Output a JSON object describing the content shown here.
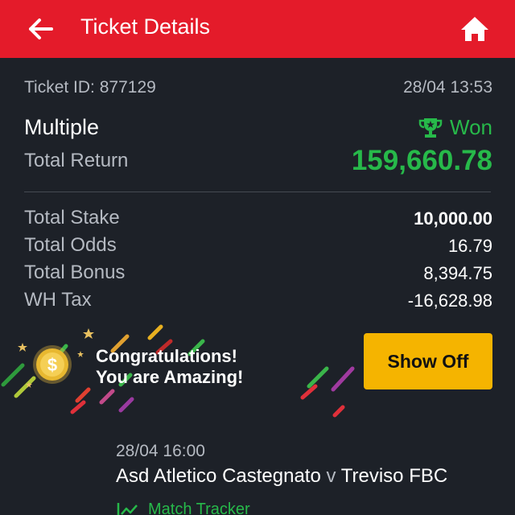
{
  "header": {
    "title": "Ticket Details",
    "back_icon": "arrow-left-icon",
    "home_icon": "home-icon",
    "background": "#e41b2a"
  },
  "ticket": {
    "id_text": "Ticket ID: 877129",
    "date": "28/04 13:53",
    "bet_type": "Multiple",
    "status": "Won",
    "status_icon": "trophy-icon",
    "status_color": "#27b94a",
    "return_label": "Total Return",
    "return_value": "159,660.78"
  },
  "summary": [
    {
      "label": "Total Stake",
      "value": "10,000.00"
    },
    {
      "label": "Total Odds",
      "value": "16.79"
    },
    {
      "label": "Total Bonus",
      "value": "8,394.75"
    },
    {
      "label": "WH Tax",
      "value": "-16,628.98"
    }
  ],
  "banner": {
    "line1": "Congratulations!",
    "line2": "You are Amazing!",
    "coin_icon": "coin-icon",
    "coin_symbol": "$",
    "button_label": "Show Off",
    "button_color": "#f5b400"
  },
  "match": {
    "date": "28/04 16:00",
    "home": "Asd Atletico Castegnato",
    "sep": "v",
    "away": "Treviso FBC",
    "tracker_label": "Match Tracker",
    "tracker_icon": "chart-line-icon"
  }
}
